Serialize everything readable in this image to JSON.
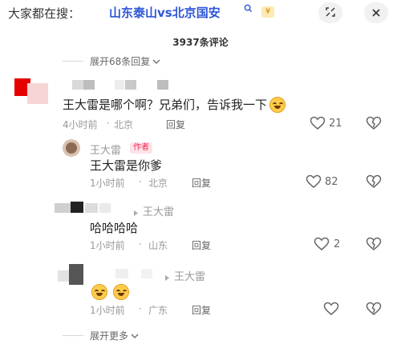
{
  "search": {
    "prefix": "大家都在搜：",
    "query": "山东泰山vs北京国安",
    "search_icon": "search-icon",
    "hot_badge": "¥"
  },
  "header": {
    "comment_count": "3937条评论",
    "collapse_icon": "collapse-icon",
    "close_icon": "close-icon"
  },
  "expand_top": "展开68条回复",
  "expand_bottom": "展开更多",
  "comments": [
    {
      "text": "王大雷是哪个啊？兄弟们，告诉我一下",
      "time": "4小时前",
      "location": "北京",
      "reply": "回复",
      "likes": "21"
    },
    {
      "author": "王大雷",
      "author_badge": "作者",
      "text": "王大雷是你爹",
      "time": "1小时前",
      "location": "北京",
      "reply": "回复",
      "likes": "82"
    },
    {
      "reply_to": "王大雷",
      "text": "哈哈哈哈",
      "time": "1小时前",
      "location": "山东",
      "reply": "回复",
      "likes": "2"
    },
    {
      "reply_to": "王大雷",
      "time": "1小时前",
      "location": "广东",
      "reply": "回复",
      "likes": ""
    }
  ],
  "colors": {
    "accent_blue": "#2f56d6",
    "author_red": "#ee2b54",
    "meta_gray": "#999999"
  }
}
